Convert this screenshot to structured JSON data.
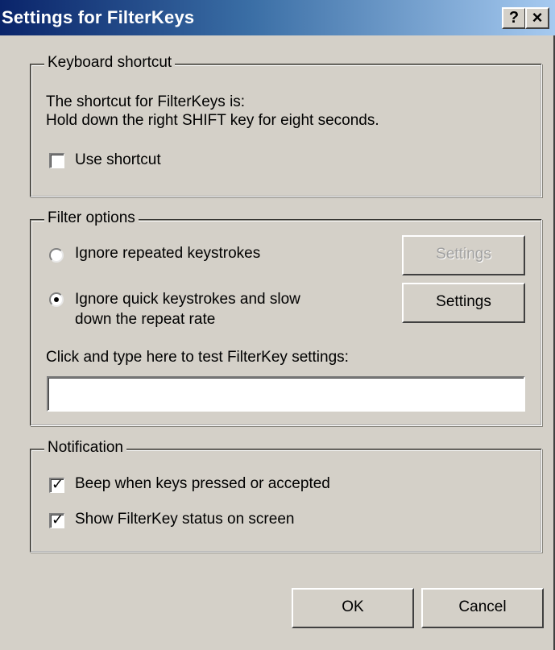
{
  "window": {
    "title": "Settings for FilterKeys",
    "help_label": "?",
    "close_label": "×"
  },
  "keyboard_shortcut": {
    "legend": "Keyboard shortcut",
    "line1": "The shortcut for FilterKeys is:",
    "line2": "Hold down the right SHIFT key for eight seconds.",
    "use_shortcut_label": "Use shortcut",
    "use_shortcut_checked": false
  },
  "filter_options": {
    "legend": "Filter options",
    "ignore_repeated_label": "Ignore repeated keystrokes",
    "ignore_repeated_selected": false,
    "ignore_quick_label_line1": "Ignore quick keystrokes and slow",
    "ignore_quick_label_line2": "down the repeat rate",
    "ignore_quick_selected": true,
    "settings_disabled_label": "Settings",
    "settings_label": "Settings",
    "test_label": "Click and type here to test FilterKey settings:",
    "test_value": ""
  },
  "notification": {
    "legend": "Notification",
    "beep_label": "Beep when keys pressed or accepted",
    "beep_checked": true,
    "status_label": "Show FilterKey status on screen",
    "status_checked": true
  },
  "buttons": {
    "ok_label": "OK",
    "cancel_label": "Cancel"
  },
  "colors": {
    "title_start": "#0a246a",
    "title_end": "#a6caf0",
    "face": "#d4d0c8"
  }
}
